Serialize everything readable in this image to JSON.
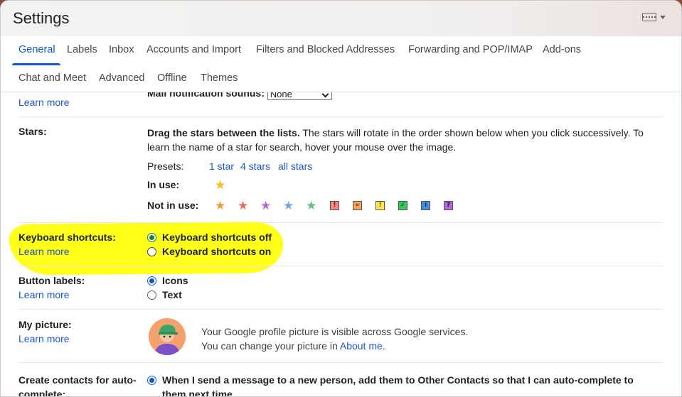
{
  "title": "Settings",
  "tabs": [
    {
      "label": "General"
    },
    {
      "label": "Labels"
    },
    {
      "label": "Inbox"
    },
    {
      "label": "Accounts and Import"
    },
    {
      "label": "Filters and Blocked Addresses"
    },
    {
      "label": "Forwarding and POP/IMAP"
    },
    {
      "label": "Add-ons"
    },
    {
      "label": "Chat and Meet"
    },
    {
      "label": "Advanced"
    },
    {
      "label": "Offline"
    },
    {
      "label": "Themes"
    }
  ],
  "mail_sounds": {
    "label": "Mail notification sounds:",
    "selected": "None",
    "learn_more": "Learn more"
  },
  "stars": {
    "label": "Stars:",
    "desc_bold": "Drag the stars between the lists.",
    "desc_line1": "The stars will rotate in the order shown below when you click successively. To",
    "desc_line2": "learn the name of a star for search, hover your mouse over the image.",
    "presets_label": "Presets:",
    "presets": [
      "1 star",
      "4 stars",
      "all stars"
    ],
    "in_use_label": "In use:",
    "not_in_use_label": "Not in use:",
    "in_use_icons": [
      "yellow-star"
    ],
    "not_in_use_icons": [
      "orange-star",
      "red-star",
      "purple-star",
      "blue-star",
      "green-star",
      "red-bang",
      "orange-guillemet",
      "yellow-bang",
      "green-check",
      "blue-info",
      "purple-question"
    ],
    "icon_colors": {
      "yellow": "#f4c20d",
      "orange": "#f09a37",
      "red": "#e66b63",
      "purple": "#b36ad6",
      "blue": "#6ea6f2",
      "green": "#5cc27a"
    },
    "icon_glyphs": {
      "red_bang": "!",
      "orange_guillemet": "»",
      "yellow_bang": "!",
      "green_check": "✓",
      "blue_info": "i",
      "purple_question": "?"
    }
  },
  "keyboard": {
    "label": "Keyboard shortcuts:",
    "learn_more": "Learn more",
    "option_off": "Keyboard shortcuts off",
    "option_on": "Keyboard shortcuts on",
    "selected": "off",
    "highlight_color": "#ffff1a"
  },
  "button_labels": {
    "label": "Button labels:",
    "learn_more": "Learn more",
    "option_icons": "Icons",
    "option_text": "Text",
    "selected": "Icons"
  },
  "my_picture": {
    "label": "My picture:",
    "learn_more": "Learn more",
    "line1": "Your Google profile picture is visible across Google services.",
    "line2_prefix": "You can change your picture in",
    "about_me": "About me",
    "line2_suffix": "."
  },
  "contacts": {
    "label_line1": "Create contacts for auto-",
    "label_line2": "complete:",
    "option_line1": "When I send a message to a new person, add them to Other Contacts so that I can auto-complete to",
    "option_line2": "them next time"
  },
  "accent_color": "#0b57d0"
}
